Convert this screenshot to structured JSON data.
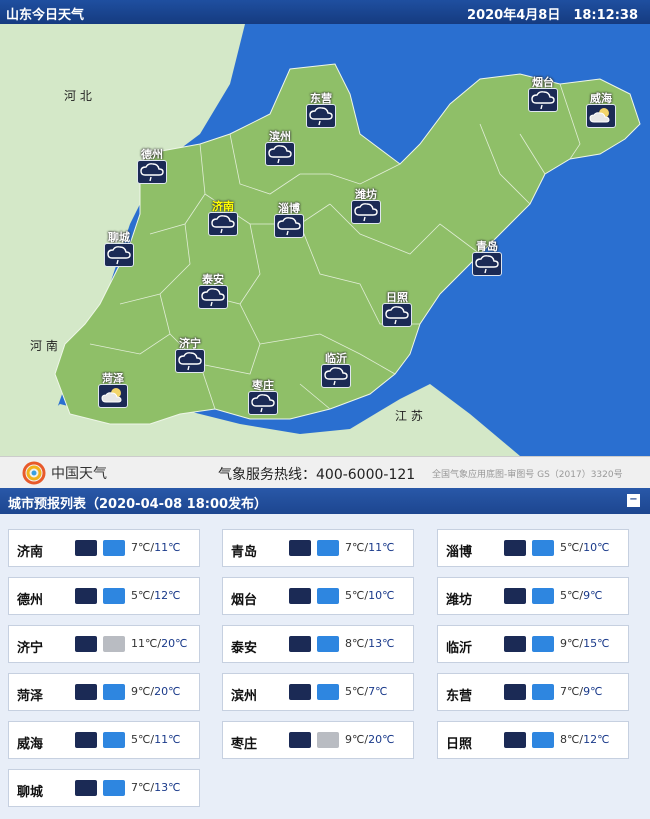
{
  "header": {
    "title": "山东今日天气",
    "datetime": "2020年4月8日　18:12:38"
  },
  "map": {
    "regions": [
      "河 北",
      "河 南",
      "江 苏"
    ],
    "cities": [
      {
        "name": "东营",
        "icon": "rain-icon",
        "highlight": false
      },
      {
        "name": "烟台",
        "icon": "rain-icon",
        "highlight": false
      },
      {
        "name": "威海",
        "icon": "cloudy-night-icon",
        "highlight": false
      },
      {
        "name": "滨州",
        "icon": "rain-icon",
        "highlight": false
      },
      {
        "name": "德州",
        "icon": "rain-icon",
        "highlight": false
      },
      {
        "name": "济南",
        "icon": "rain-icon",
        "highlight": true
      },
      {
        "name": "淄博",
        "icon": "rain-icon",
        "highlight": false
      },
      {
        "name": "潍坊",
        "icon": "rain-icon",
        "highlight": false
      },
      {
        "name": "聊城",
        "icon": "rain-icon",
        "highlight": false
      },
      {
        "name": "青岛",
        "icon": "rain-icon",
        "highlight": false
      },
      {
        "name": "泰安",
        "icon": "rain-icon",
        "highlight": false
      },
      {
        "name": "日照",
        "icon": "rain-icon",
        "highlight": false
      },
      {
        "name": "济宁",
        "icon": "rain-icon",
        "highlight": false
      },
      {
        "name": "临沂",
        "icon": "rain-icon",
        "highlight": false
      },
      {
        "name": "菏泽",
        "icon": "cloudy-night-icon",
        "highlight": false
      },
      {
        "name": "枣庄",
        "icon": "rain-icon",
        "highlight": false
      }
    ],
    "colors": {
      "sea": "#2a6fd0",
      "land": "#8fbf68",
      "neighbor": "#d4e8c8"
    }
  },
  "footer": {
    "logo": "中国天气",
    "hotline": "气象服务热线：400-6000-121",
    "copyright": "全国气象应用底图-审图号 GS（2017）3320号"
  },
  "list": {
    "title": "城市预报列表（2020-04-08 18:00发布）",
    "collapse": "−",
    "rows": [
      {
        "name": "济南",
        "lo": "7℃",
        "hi": "11℃",
        "icon2": "rain"
      },
      {
        "name": "青岛",
        "lo": "7℃",
        "hi": "11℃",
        "icon2": "rain"
      },
      {
        "name": "淄博",
        "lo": "5℃",
        "hi": "10℃",
        "icon2": "rain"
      },
      {
        "name": "德州",
        "lo": "5℃",
        "hi": "12℃",
        "icon2": "rain"
      },
      {
        "name": "烟台",
        "lo": "5℃",
        "hi": "10℃",
        "icon2": "rain"
      },
      {
        "name": "潍坊",
        "lo": "5℃",
        "hi": "9℃",
        "icon2": "rain"
      },
      {
        "name": "济宁",
        "lo": "11℃",
        "hi": "20℃",
        "icon2": "cloud"
      },
      {
        "name": "泰安",
        "lo": "8℃",
        "hi": "13℃",
        "icon2": "rain"
      },
      {
        "name": "临沂",
        "lo": "9℃",
        "hi": "15℃",
        "icon2": "rain"
      },
      {
        "name": "菏泽",
        "lo": "9℃",
        "hi": "20℃",
        "icon2": "rain"
      },
      {
        "name": "滨州",
        "lo": "5℃",
        "hi": "7℃",
        "icon2": "rain"
      },
      {
        "name": "东营",
        "lo": "7℃",
        "hi": "9℃",
        "icon2": "rain"
      },
      {
        "name": "威海",
        "lo": "5℃",
        "hi": "11℃",
        "icon2": "rain"
      },
      {
        "name": "枣庄",
        "lo": "9℃",
        "hi": "20℃",
        "icon2": "cloud"
      },
      {
        "name": "日照",
        "lo": "8℃",
        "hi": "12℃",
        "icon2": "rain"
      },
      {
        "name": "聊城",
        "lo": "7℃",
        "hi": "13℃",
        "icon2": "rain"
      }
    ]
  }
}
